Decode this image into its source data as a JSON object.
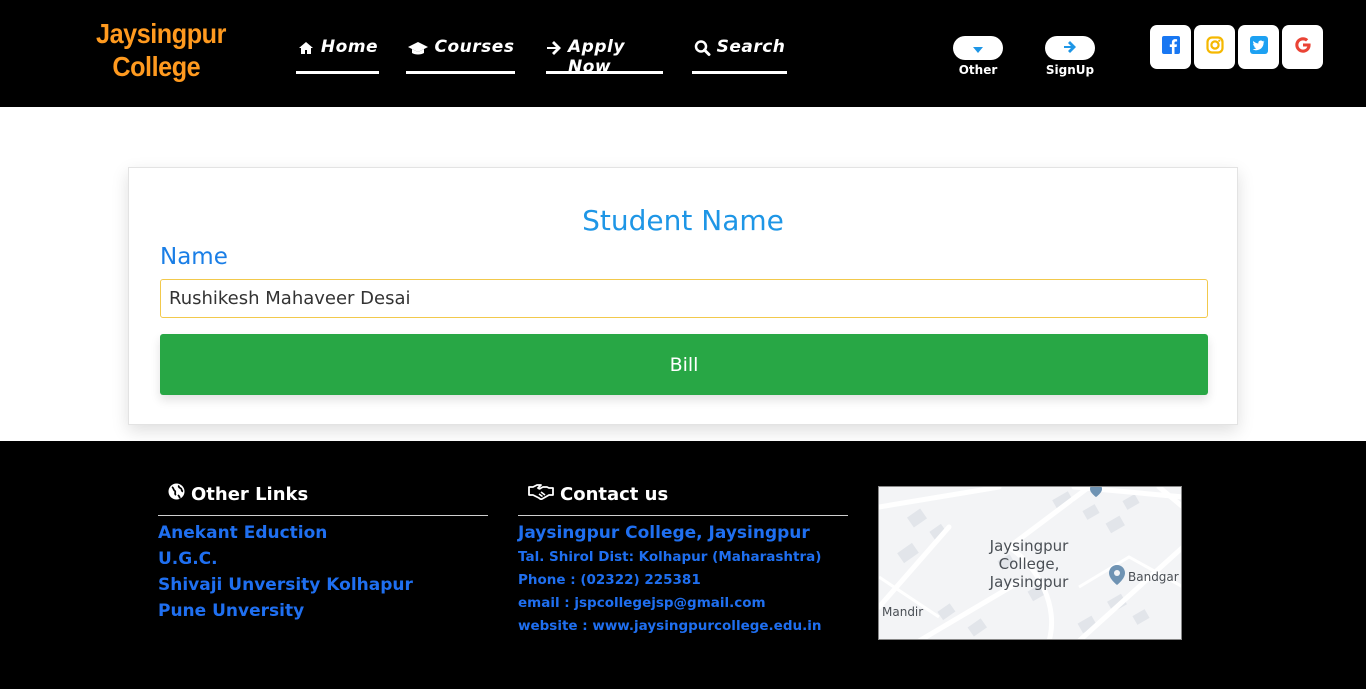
{
  "header": {
    "brand_line1": "Jaysingpur",
    "brand_line2": "College",
    "nav": [
      {
        "label": "Home",
        "icon": "home-icon"
      },
      {
        "label": "Courses",
        "icon": "graduation-cap-icon"
      },
      {
        "label": "Apply Now",
        "icon": "arrow-right-icon"
      },
      {
        "label": "Search",
        "icon": "search-icon"
      }
    ],
    "other_label": "Other",
    "signup_label": "SignUp",
    "social": [
      {
        "name": "facebook-icon",
        "color": "#1877f2"
      },
      {
        "name": "instagram-icon",
        "color": "#f5b800"
      },
      {
        "name": "twitter-icon",
        "color": "#1da1f2"
      },
      {
        "name": "google-icon",
        "color": "#ea4335"
      }
    ]
  },
  "form": {
    "title": "Student Name",
    "name_label": "Name",
    "name_value": "Rushikesh Mahaveer Desai",
    "button_label": "Bill"
  },
  "footer": {
    "links_heading": "Other Links",
    "links": [
      "Anekant Eduction",
      "U.G.C.",
      "Shivaji Unversity Kolhapur",
      "Pune Unversity"
    ],
    "contact_heading": "Contact us",
    "contact_title": "Jaysingpur College, Jaysingpur",
    "contact_lines": [
      "Tal. Shirol Dist: Kolhapur (Maharashtra)",
      "Phone : (02322) 225381",
      "email : jspcollegejsp@gmail.com",
      "website : www.jaysingpurcollege.edu.in"
    ],
    "map": {
      "place_line1": "Jaysingpur",
      "place_line2": "College,",
      "place_line3": "Jaysingpur",
      "poi_right": "Bandgar",
      "poi_left": "Mandir"
    }
  },
  "colors": {
    "brand": "#ff9a1f",
    "accent_blue": "#1e96e6",
    "link_blue": "#1f6ff0",
    "button_green": "#28a745",
    "input_border": "#f2c94c"
  }
}
